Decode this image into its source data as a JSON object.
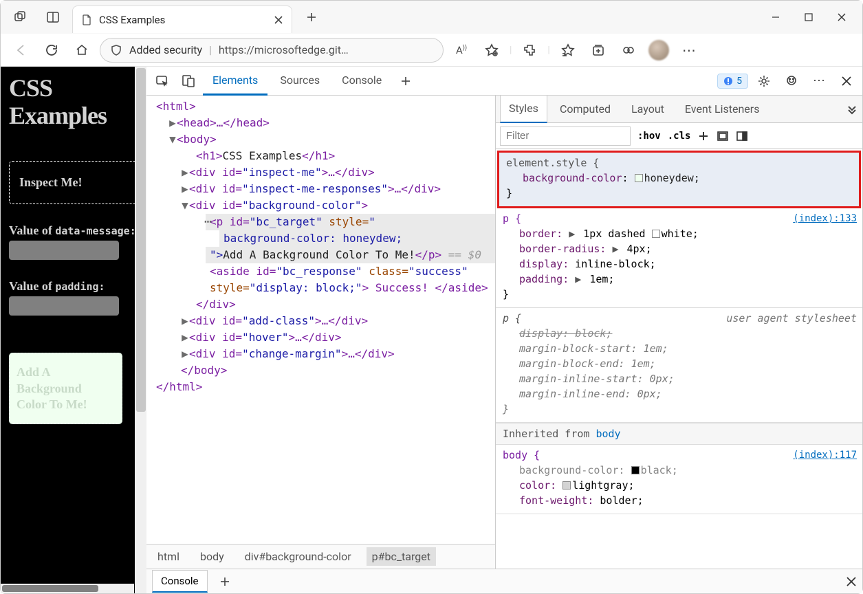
{
  "browser": {
    "tab_title": "CSS Examples",
    "security_label": "Added security",
    "url": "https://microsoftedge.git…",
    "issue_count": "5"
  },
  "devtools_tabs": {
    "elements": "Elements",
    "sources": "Sources",
    "console": "Console"
  },
  "rendered": {
    "heading": "CSS Examples",
    "inspect": "Inspect Me!",
    "val1": "Value of ",
    "val1b": "data-message:",
    "val2": "Value of ",
    "val2b": "padding:",
    "bgbox": "Add A Background Color To Me!"
  },
  "dom": {
    "html_open": "<html>",
    "head": "<head>…</head>",
    "body_open": "<body>",
    "h1_open": "<h1>",
    "h1_txt": "CSS Examples",
    "h1_close": "</h1>",
    "d1o": "<div id=",
    "d1v": "\"inspect-me\"",
    "d1c": ">…</div>",
    "d2o": "<div id=",
    "d2v": "\"inspect-me-responses\"",
    "d2c": ">…</div>",
    "d3o": "<div id=",
    "d3v": "\"background-color\"",
    "d3c": ">",
    "po": "<p id=",
    "pv1": "\"bc_target\"",
    "pstyle": " style=",
    "pv2": "\"",
    "pstylec": "background-color: honeydew;",
    "pend": "\">",
    "ptxt": "Add A Background Color To Me!",
    "pclose": "</p>",
    "cmt": " == $0",
    "asideo": "<aside id=",
    "asidev": "\"bc_response\"",
    "asidec": " class=",
    "asideclv": "\"success\"",
    "asides": "style=",
    "asidesv": "\"display: block;\"",
    "asidect": "> Success! </aside>",
    "divclose": "</div>",
    "d4o": "<div id=",
    "d4v": "\"add-class\"",
    "d4c": ">…</div>",
    "d5o": "<div id=",
    "d5v": "\"hover\"",
    "d5c": ">…</div>",
    "d6o": "<div id=",
    "d6v": "\"change-margin\"",
    "d6c": ">…</div>",
    "body_close": "</body>",
    "html_close": "</html>"
  },
  "breadcrumbs": {
    "a": "html",
    "b": "body",
    "c": "div#background-color",
    "d": "p#bc_target"
  },
  "styles_tabs": {
    "styles": "Styles",
    "computed": "Computed",
    "layout": "Layout",
    "el": "Event Listeners"
  },
  "styles": {
    "filter_placeholder": "Filter",
    "hov": ":hov",
    "cls": ".cls",
    "el_style": "element.style {",
    "bg_prop": "background-color",
    "bg_val": "honeydew;",
    "brace_c": "}",
    "p_rule": "p {",
    "p_link": "(index):133",
    "border_p": "border:",
    "border_v": "1px dashed ",
    "border_vc": "white;",
    "radius_p": "border-radius:",
    "radius_v": "4px;",
    "display_p": "display:",
    "display_v": "inline-block;",
    "padding_p": "padding:",
    "padding_v": "1em;",
    "ua_label": "user agent stylesheet",
    "ua_disp": "display: block;",
    "mbs": "margin-block-start:",
    "mbs_v": "1em;",
    "mbe": "margin-block-end:",
    "mbe_v": "1em;",
    "mis": "margin-inline-start:",
    "mis_v": "0px;",
    "mie": "margin-inline-end:",
    "mie_v": "0px;",
    "inh": "Inherited from ",
    "inh_link": "body",
    "body_rule": "body {",
    "body_link": "(index):117",
    "body_bg_p": "background-color:",
    "body_bg_v": "black;",
    "body_color_p": "color:",
    "body_color_v": "lightgray;",
    "body_fw_p": "font-weight:",
    "body_fw_v": "bolder;"
  },
  "drawer": {
    "console": "Console"
  }
}
